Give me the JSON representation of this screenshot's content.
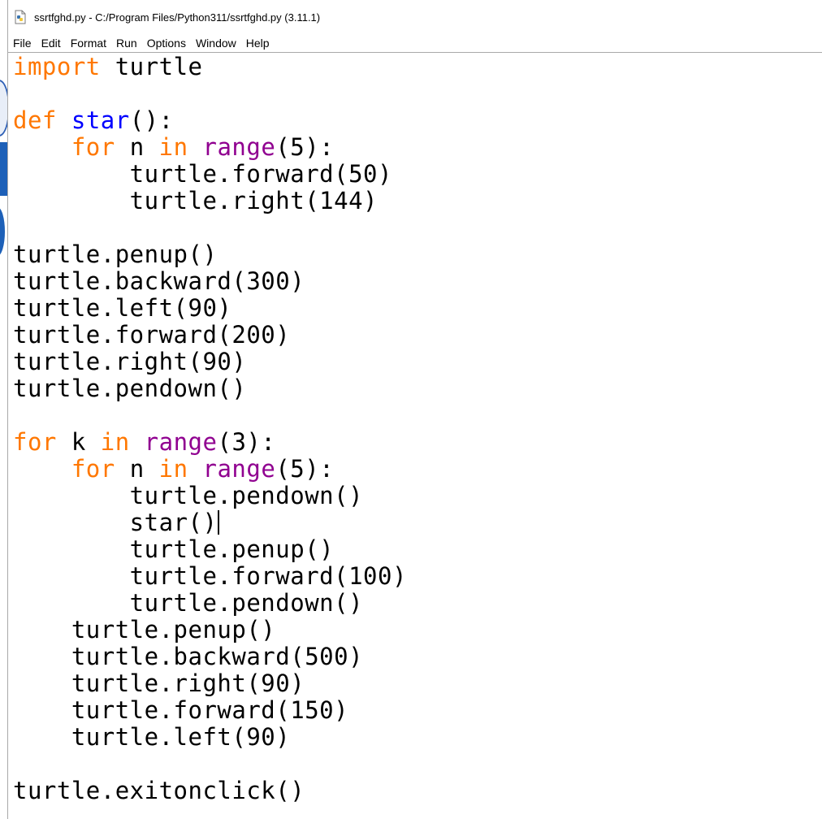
{
  "window": {
    "title": "ssrtfghd.py - C:/Program Files/Python311/ssrtfghd.py (3.11.1)",
    "icon": "python-file-icon"
  },
  "menu": [
    {
      "id": "file",
      "label": "File"
    },
    {
      "id": "edit",
      "label": "Edit"
    },
    {
      "id": "format",
      "label": "Format"
    },
    {
      "id": "run",
      "label": "Run"
    },
    {
      "id": "options",
      "label": "Options"
    },
    {
      "id": "window",
      "label": "Window"
    },
    {
      "id": "help",
      "label": "Help"
    }
  ],
  "colors": {
    "keyword": "#ff7700",
    "builtin": "#900090",
    "definition": "#0000ff",
    "text": "#000000"
  },
  "cursor": {
    "line": 17
  },
  "code_lines": [
    [
      [
        "kw",
        "import"
      ],
      [
        "plain",
        " turtle"
      ]
    ],
    [],
    [
      [
        "kw",
        "def"
      ],
      [
        "plain",
        " "
      ],
      [
        "defname",
        "star"
      ],
      [
        "plain",
        "():"
      ]
    ],
    [
      [
        "plain",
        "    "
      ],
      [
        "kw",
        "for"
      ],
      [
        "plain",
        " n "
      ],
      [
        "kw",
        "in"
      ],
      [
        "plain",
        " "
      ],
      [
        "builtin",
        "range"
      ],
      [
        "plain",
        "(5):"
      ]
    ],
    [
      [
        "plain",
        "        turtle.forward(50)"
      ]
    ],
    [
      [
        "plain",
        "        turtle.right(144)"
      ]
    ],
    [],
    [
      [
        "plain",
        "turtle.penup()"
      ]
    ],
    [
      [
        "plain",
        "turtle.backward(300)"
      ]
    ],
    [
      [
        "plain",
        "turtle.left(90)"
      ]
    ],
    [
      [
        "plain",
        "turtle.forward(200)"
      ]
    ],
    [
      [
        "plain",
        "turtle.right(90)"
      ]
    ],
    [
      [
        "plain",
        "turtle.pendown()"
      ]
    ],
    [],
    [
      [
        "kw",
        "for"
      ],
      [
        "plain",
        " k "
      ],
      [
        "kw",
        "in"
      ],
      [
        "plain",
        " "
      ],
      [
        "builtin",
        "range"
      ],
      [
        "plain",
        "(3):"
      ]
    ],
    [
      [
        "plain",
        "    "
      ],
      [
        "kw",
        "for"
      ],
      [
        "plain",
        " n "
      ],
      [
        "kw",
        "in"
      ],
      [
        "plain",
        " "
      ],
      [
        "builtin",
        "range"
      ],
      [
        "plain",
        "(5):"
      ]
    ],
    [
      [
        "plain",
        "        turtle.pendown()"
      ]
    ],
    [
      [
        "plain",
        "        star()"
      ]
    ],
    [
      [
        "plain",
        "        turtle.penup()"
      ]
    ],
    [
      [
        "plain",
        "        turtle.forward(100)"
      ]
    ],
    [
      [
        "plain",
        "        turtle.pendown()"
      ]
    ],
    [
      [
        "plain",
        "    turtle.penup()"
      ]
    ],
    [
      [
        "plain",
        "    turtle.backward(500)"
      ]
    ],
    [
      [
        "plain",
        "    turtle.right(90)"
      ]
    ],
    [
      [
        "plain",
        "    turtle.forward(150)"
      ]
    ],
    [
      [
        "plain",
        "    turtle.left(90)"
      ]
    ],
    [],
    [
      [
        "plain",
        "turtle.exitonclick()"
      ]
    ]
  ]
}
